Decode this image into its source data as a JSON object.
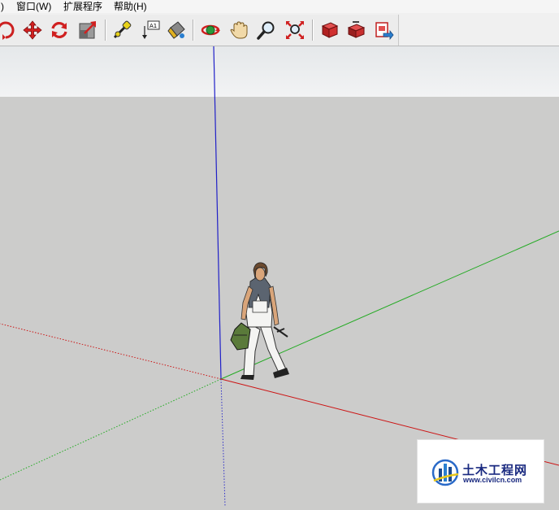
{
  "menu": {
    "partial_item": ")",
    "window": "窗口(W)",
    "extensions": "扩展程序",
    "help": "帮助(H)"
  },
  "toolbar": {
    "tools": [
      "orbit-icon",
      "move-icon",
      "rotate-icon",
      "scale-icon",
      "tape-measure-icon",
      "text-icon",
      "paint-bucket-icon",
      "orbit-icon",
      "pan-hand-icon",
      "zoom-icon",
      "zoom-extents-icon",
      "3d-warehouse-icon",
      "share-model-icon",
      "send-to-layout-icon"
    ]
  },
  "viewport": {
    "sky_color": "#e9ebec",
    "ground_color": "#cccccb",
    "axis_colors": {
      "red": "#cc1111",
      "green": "#11aa11",
      "blue": "#1111cc"
    }
  },
  "watermark": {
    "name": "土木工程网",
    "url": "www.civilcn.com"
  }
}
